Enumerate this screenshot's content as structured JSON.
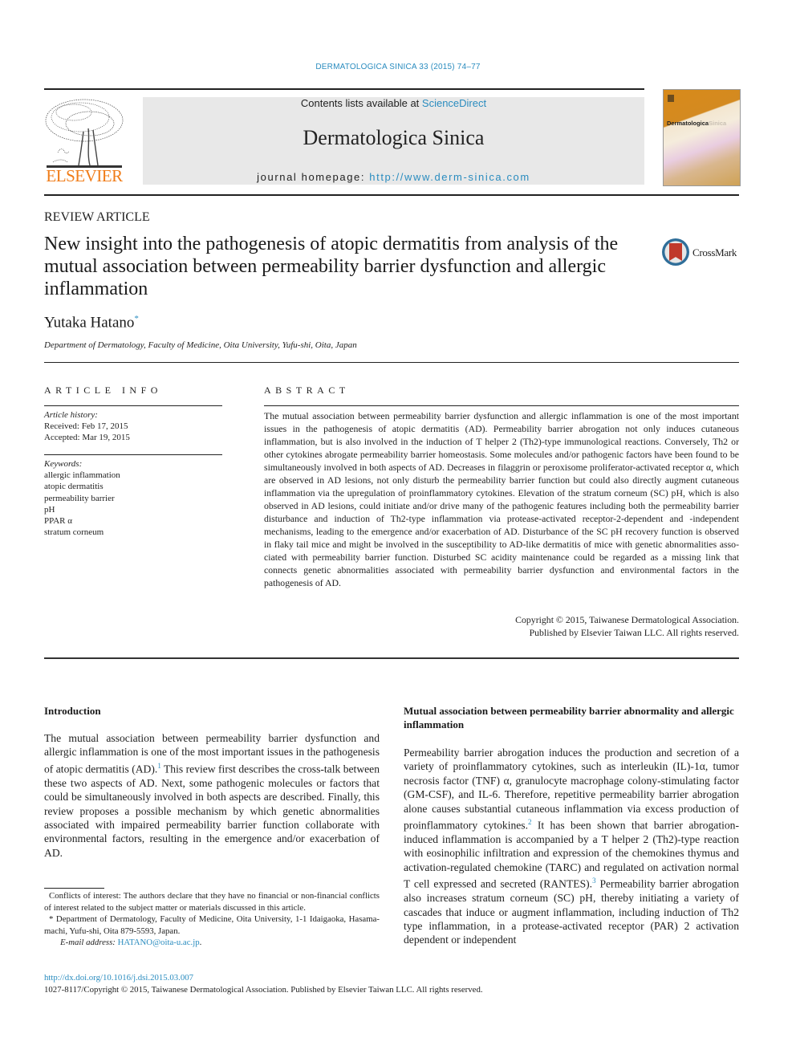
{
  "running_head": "DERMATOLOGICA SINICA 33 (2015) 74–77",
  "publisher": {
    "logo_text": "ELSEVIER",
    "logo_color": "#f07c18"
  },
  "banner": {
    "contents_prefix": "Contents lists available at ",
    "contents_link": "ScienceDirect",
    "journal_name": "Dermatologica Sinica",
    "homepage_prefix": "journal homepage: ",
    "homepage_link": "http://www.derm-sinica.com"
  },
  "cover": {
    "title_main": "Dermatologica",
    "title_accent": "Sinica"
  },
  "crossmark": {
    "label": "CrossMark"
  },
  "article": {
    "type": "REVIEW ARTICLE",
    "title": "New insight into the pathogenesis of atopic dermatitis from analysis of the mutual association between permeability barrier dysfunction and allergic inflammation",
    "author": "Yutaka Hatano",
    "author_mark": "*",
    "affiliation": "Department of Dermatology, Faculty of Medicine, Oita University, Yufu-shi, Oita, Japan"
  },
  "article_info": {
    "heading": "ARTICLE INFO",
    "history_label": "Article history:",
    "received": "Received: Feb 17, 2015",
    "accepted": "Accepted: Mar 19, 2015",
    "keywords_label": "Keywords:",
    "keywords": [
      "allergic inflammation",
      "atopic dermatitis",
      "permeability barrier",
      "pH",
      "PPAR α",
      "stratum corneum"
    ]
  },
  "abstract": {
    "heading": "ABSTRACT",
    "body": "The mutual association between permeability barrier dysfunction and allergic inflammation is one of the most important issues in the pathogenesis of atopic dermatitis (AD). Permeability barrier abrogation not only induces cutaneous inflammation, but is also involved in the induction of T helper 2 (Th2)-type immunological reactions. Conversely, Th2 or other cytokines abrogate permeability barrier homeostasis. Some molecules and/or pathogenic factors have been found to be simultaneously involved in both as­pects of AD. Decreases in filaggrin or peroxisome proliferator-activated receptor α, which are observed in AD lesions, not only disturb the permeability barrier function but could also directly augment cutaneous inflammation via the upregulation of proinflammatory cytokines. Elevation of the stratum corneum (SC) pH, which is also observed in AD lesions, could initiate and/or drive many of the pathogenic features including both the permeability barrier disturbance and induction of Th2-type inflammation via protease-activated receptor-2-dependent and -independent mechanisms, leading to the emergence and/​or exacerbation of AD. Disturbance of the SC pH recovery function is observed in flaky tail mice and might be involved in the susceptibility to AD-like dermatitis of mice with genetic abnormalities asso­ciated with permeability barrier function. Disturbed SC acidity maintenance could be regarded as a missing link that connects genetic abnormalities associated with permeability barrier dysfunction and environmental factors in the pathogenesis of AD.",
    "copyright_line1": "Copyright © 2015, Taiwanese Dermatological Association.",
    "copyright_line2": "Published by Elsevier Taiwan LLC. All rights reserved."
  },
  "introduction": {
    "heading": "Introduction",
    "text_part1": "The mutual association between permeability barrier dysfunction and allergic inflammation is one of the most important issues in the pathogenesis of atopic dermatitis (AD).",
    "ref1": "1",
    "text_part2": " This review first describes the cross-talk between these two aspects of AD. Next, some path­ogenic molecules or factors that could be simultaneously involved in both aspects are described. Finally, this review proposes a possible mechanism by which genetic abnormalities associated with impaired permeability barrier function collaborate with environmental factors, resulting in the emergence and/or exacer­bation of AD."
  },
  "mutual_section": {
    "heading": "Mutual association between permeability barrier abnormality and allergic inflammation",
    "text_part1": "Permeability barrier abrogation induces the production and secre­tion of a variety of proinflammatory cytokines, such as interleukin (IL)-1α, tumor necrosis factor (TNF) α, granulocyte macrophage colony-stimulating factor (GM-CSF), and IL-6. Therefore, repetitive permeability barrier abrogation alone causes substantial cutaneous inflammation via excess production of proinflammatory cytokines.",
    "ref2": "2",
    "text_part2": " It has been shown that barrier abrogation-induced inflammation is accompanied by a T helper 2 (Th2)-type reaction with eosinophilic infiltration and expression of the chemokines thymus and activation-regulated chemokine (TARC) and regulated on activation normal T cell expressed and secreted (RANTES).",
    "ref3": "3",
    "text_part3": " Permeability bar­rier abrogation also increases stratum corneum (SC) pH, thereby initiating a variety of cascades that induce or augment inflamma­tion, including induction of Th2 type inflammation, in a protease-activated receptor (PAR) 2 activation dependent or independent"
  },
  "footnotes": {
    "conflicts": "Conflicts of interest: The authors declare that they have no financial or non-financial conflicts of interest related to the subject matter or materials discussed in this article.",
    "correspondence": "* Department of Dermatology, Faculty of Medicine, Oita University, 1-1 Idaigaoka, Hasama-machi, Yufu-shi, Oita 879-5593, Japan.",
    "email_label": "E-mail address: ",
    "email": "HATANO@oita-u.ac.jp",
    "email_suffix": "."
  },
  "footer": {
    "doi": "http://dx.doi.org/10.1016/j.dsi.2015.03.007",
    "issn_copyright": "1027-8117/Copyright © 2015, Taiwanese Dermatological Association. Published by Elsevier Taiwan LLC. All rights reserved."
  },
  "colors": {
    "link": "#2a8cbf",
    "banner_bg": "#e8e8e8",
    "crossmark_red": "#c0392b",
    "crossmark_blue": "#2f6e99"
  }
}
